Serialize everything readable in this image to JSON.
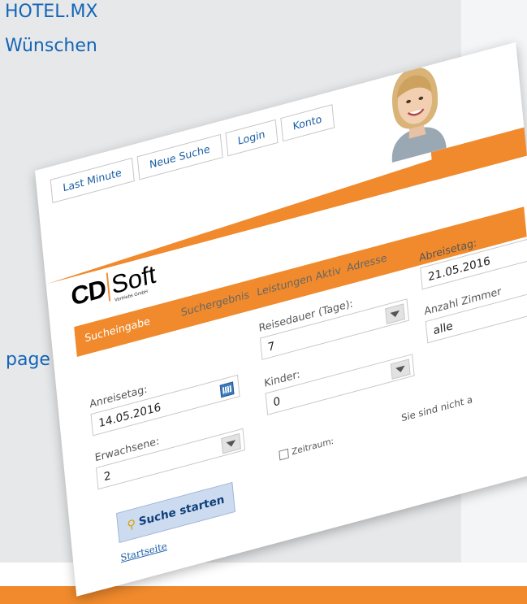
{
  "background": {
    "line1": "HOTEL.MX",
    "line2": "Wünschen",
    "line3": "page"
  },
  "nav": {
    "last_minute": "Last Minute",
    "neue_suche": "Neue Suche",
    "login": "Login",
    "konto": "Konto"
  },
  "logo": {
    "cd": "CD",
    "soft": "Soft",
    "sub": "Vertriebs GmbH"
  },
  "steps": [
    "Sucheingabe",
    "Suchergebnis",
    "Leistungen Aktiv",
    "Adresse",
    ""
  ],
  "form": {
    "anreisetag": {
      "label": "Anreisetag:",
      "value": "14.05.2016"
    },
    "reisedauer": {
      "label": "Reisedauer (Tage):",
      "value": "7"
    },
    "abreisetag": {
      "label": "Abreisetag:",
      "value": "21.05.2016"
    },
    "erwachsene": {
      "label": "Erwachsene:",
      "value": "2"
    },
    "kinder": {
      "label": "Kinder:",
      "value": "0"
    },
    "anzahl_zimmer": {
      "label": "Anzahl Zimmer",
      "value": "alle"
    },
    "zeitraum_label": "Zeitraum:"
  },
  "buttons": {
    "suche_starten": "Suche starten"
  },
  "links": {
    "startseite": "Startseite"
  },
  "status": "Sie sind nicht a",
  "colors": {
    "accent_orange": "#f08a2c",
    "link_blue": "#1c5fa5",
    "background_grey": "#e6e8ea"
  },
  "icons": {
    "calendar": "calendar-icon",
    "dropdown": "chevron-down-icon",
    "search": "key-search-icon"
  }
}
